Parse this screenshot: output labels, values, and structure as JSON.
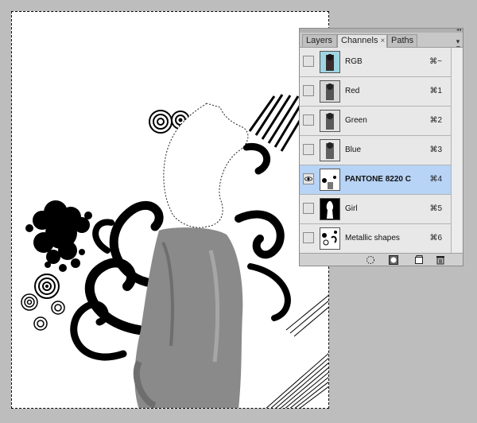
{
  "panel": {
    "tabs": [
      {
        "label": "Layers",
        "active": false
      },
      {
        "label": "Channels",
        "active": true,
        "close_glyph": "×"
      },
      {
        "label": "Paths",
        "active": false
      }
    ],
    "menu_icon": "panel-menu-icon",
    "channels": [
      {
        "name": "RGB",
        "shortcut": "⌘~",
        "visible": false,
        "selected": false
      },
      {
        "name": "Red",
        "shortcut": "⌘1",
        "visible": false,
        "selected": false
      },
      {
        "name": "Green",
        "shortcut": "⌘2",
        "visible": false,
        "selected": false
      },
      {
        "name": "Blue",
        "shortcut": "⌘3",
        "visible": false,
        "selected": false
      },
      {
        "name": "PANTONE 8220 C",
        "shortcut": "⌘4",
        "visible": true,
        "selected": true
      },
      {
        "name": "Girl",
        "shortcut": "⌘5",
        "visible": false,
        "selected": false
      },
      {
        "name": "Metallic shapes",
        "shortcut": "⌘6",
        "visible": false,
        "selected": false
      }
    ],
    "bottom_buttons": [
      "load-selection-icon",
      "save-selection-icon",
      "new-channel-icon",
      "delete-channel-icon"
    ]
  },
  "colors": {
    "workspace": "#bdbdbd",
    "selected_row": "#b7d3f5",
    "panel_bg": "#d9d9d9"
  }
}
